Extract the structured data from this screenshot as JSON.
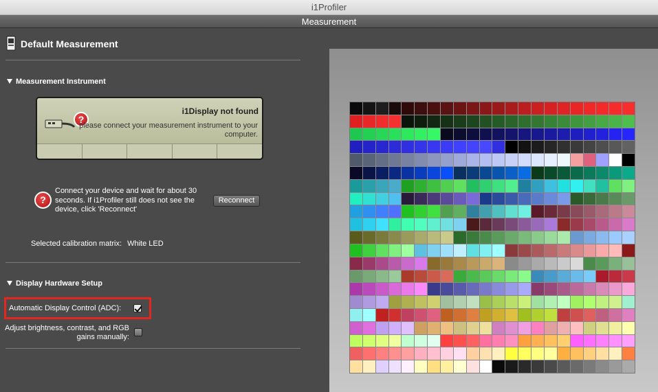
{
  "window": {
    "title": "i1Profiler"
  },
  "tab": {
    "label": "Measurement"
  },
  "header": {
    "title": "Default Measurement",
    "icon": "document-icon"
  },
  "instrument": {
    "section_title": "Measurement Instrument",
    "device_status": "i1Display not found",
    "device_message": "please connect your measurement instrument to your computer.",
    "help_text": "Connect your device and wait for about 30 seconds. If i1Profiler still does not see the device, click 'Reconnect'",
    "reconnect_label": "Reconnect",
    "calibration_label": "Selected calibration matrix:",
    "calibration_value": "White LED"
  },
  "hardware": {
    "section_title": "Display Hardware Setup",
    "adc_label": "Automatic Display Control (ADC):",
    "adc_checked": true,
    "manual_label": "Adjust brightness, contrast, and RGB gains manually:",
    "manual_checked": false
  },
  "colors": {
    "highlight": "#e5261e",
    "patches": [
      "#0a0a0a",
      "#141414",
      "#1e1e1e",
      "#1a0a0a",
      "#300a0a",
      "#3c0e0e",
      "#4a1010",
      "#5a1212",
      "#6a1414",
      "#7a1616",
      "#8a1818",
      "#9a1a1a",
      "#aa1c1c",
      "#ba1e1e",
      "#ca2020",
      "#d42222",
      "#de2424",
      "#e82626",
      "#ef2828",
      "#f22a2a",
      "#f42c2c",
      "#f62e2e",
      "#e02020",
      "#e82828",
      "#f02c2c",
      "#f43030",
      "#0a140a",
      "#0e1e0e",
      "#122812",
      "#163216",
      "#1a3c1a",
      "#1e461e",
      "#225022",
      "#265a26",
      "#2a642a",
      "#2e6e2e",
      "#327832",
      "#368236",
      "#3a8c3a",
      "#3e963e",
      "#42a042",
      "#46aa46",
      "#4ab44a",
      "#4ebe4e",
      "#1ec84e",
      "#22d052",
      "#26d856",
      "#2ae05a",
      "#2ee85e",
      "#32f062",
      "#36f866",
      "#0a0a1e",
      "#0c0c2e",
      "#0e0e3e",
      "#10104e",
      "#12125e",
      "#14146e",
      "#16167e",
      "#18188e",
      "#1a1a9e",
      "#1c1cae",
      "#1e1ebe",
      "#2020ce",
      "#2222de",
      "#2424ee",
      "#2626fe",
      "#2020c0",
      "#2424c8",
      "#2828d0",
      "#2c2cd8",
      "#3030e0",
      "#3434e8",
      "#3838f0",
      "#3c3cf8",
      "#4040ff",
      "#4444ff",
      "#4848ff",
      "#3030e0",
      "#000000",
      "#121212",
      "#1c1c1c",
      "#262626",
      "#303030",
      "#3a3a3a",
      "#444444",
      "#4e4e4e",
      "#585858",
      "#626262",
      "#505a6a",
      "#5a6478",
      "#646e86",
      "#6e7894",
      "#7882a2",
      "#828cb0",
      "#8c96be",
      "#96a0cc",
      "#a0aada",
      "#aab4e8",
      "#b4bef0",
      "#bec8f4",
      "#c8d2f8",
      "#d2dcfc",
      "#dce6ff",
      "#e6f0ff",
      "#f0f8ff",
      "#f4a0a0",
      "#e06080",
      "#a0a0ff",
      "#ffffff",
      "#000000",
      "#0a0a28",
      "#0a1446",
      "#0a1e64",
      "#0a2882",
      "#0a32a0",
      "#0a3cbe",
      "#0a46dc",
      "#0a50fa",
      "#0a3060",
      "#0a3c7a",
      "#0a4894",
      "#0a54ae",
      "#0a60c8",
      "#0a6ce2",
      "#0a3a1a",
      "#0a4a2a",
      "#0a5a3a",
      "#0a6a4a",
      "#0a7a5a",
      "#0a8a6a",
      "#0a9a7a",
      "#0aaa8a",
      "#1a9a9a",
      "#2aa0aa",
      "#3aa6ba",
      "#4aacca",
      "#20a020",
      "#30b030",
      "#40c040",
      "#50d050",
      "#60e060",
      "#20c060",
      "#30d070",
      "#40e080",
      "#50f090",
      "#2080a0",
      "#30a0c0",
      "#40c0e0",
      "#20e0e0",
      "#30f0f0",
      "#40e0c0",
      "#20c0a0",
      "#60e060",
      "#80f080",
      "#20f0c0",
      "#30e0d0",
      "#40d0e0",
      "#50c0f0",
      "#2a1a3a",
      "#3a2a5a",
      "#4a3a7a",
      "#5a4a9a",
      "#6a5aba",
      "#7a6ada",
      "#1a3a8a",
      "#2a4a9a",
      "#3a5aaa",
      "#4a6aba",
      "#5a7aca",
      "#6a8ada",
      "#7a9aea",
      "#2a5a2a",
      "#3a6a3a",
      "#4a7a4a",
      "#5a8a5a",
      "#6a9a6a",
      "#20a0e0",
      "#3090f0",
      "#4080ff",
      "#5070ff",
      "#20c020",
      "#30d030",
      "#40e040",
      "#50a050",
      "#60b060",
      "#3080a0",
      "#40a0b0",
      "#50c0c0",
      "#60e0d0",
      "#70f0e0",
      "#5a1a2a",
      "#6a2a3a",
      "#7a3a4a",
      "#8a4a5a",
      "#9a5a6a",
      "#aa6a7a",
      "#ba7a8a",
      "#ca8a9a",
      "#20c0e0",
      "#30d0f0",
      "#40e0ff",
      "#30f0a0",
      "#40ffb0",
      "#50ffc0",
      "#60f0d0",
      "#70e0e0",
      "#80d0f0",
      "#4a1a1a",
      "#5a2a3a",
      "#6a3a5a",
      "#7a4a7a",
      "#8a5a9a",
      "#9a6aba",
      "#aa7ada",
      "#8a2a2a",
      "#9a3a4a",
      "#aa4a6a",
      "#ba5a8a",
      "#ca6aaa",
      "#da7aca",
      "#5a5a1a",
      "#6a6a2a",
      "#7a7a3a",
      "#8a8a4a",
      "#9a9a5a",
      "#aaaa6a",
      "#baba7a",
      "#caca8a",
      "#2a6a2a",
      "#3a7a3a",
      "#4a8a4a",
      "#5a9a5a",
      "#6aaa6a",
      "#7aba7a",
      "#8aca8a",
      "#9ada9a",
      "#aaeaaa",
      "#6a9ad0",
      "#7aaae0",
      "#8abaf0",
      "#9acaff",
      "#aad0ff",
      "#20c020",
      "#40d040",
      "#60e060",
      "#80f080",
      "#a0ffa0",
      "#60c0e0",
      "#80d0f0",
      "#a0e0ff",
      "#c0f0ff",
      "#60e0e0",
      "#80f0f0",
      "#a0ffff",
      "#8a3a3a",
      "#9a4a4a",
      "#aa5a5a",
      "#ba6a6a",
      "#ca7a7a",
      "#da8a8a",
      "#ea9a9a",
      "#faaaaa",
      "#ffbaba",
      "#8a1a1a",
      "#8a2a4a",
      "#9a3a6a",
      "#aa4a8a",
      "#ba5aaa",
      "#ca6aca",
      "#da7aea",
      "#8a6a2a",
      "#9a7a3a",
      "#aa8a4a",
      "#ba9a5a",
      "#caaa6a",
      "#dab47a",
      "#8a8a8a",
      "#9a9a9a",
      "#aaaaaa",
      "#bababa",
      "#cacaca",
      "#dadada",
      "#4a8a4a",
      "#5a9a5a",
      "#7ab07a",
      "#9ac09a",
      "#6a9a6a",
      "#7aaa7a",
      "#8aba8a",
      "#9aca9a",
      "#aa3a2a",
      "#ba4a3a",
      "#ca5a4a",
      "#da6a5a",
      "#3aaa3a",
      "#4aba4a",
      "#5aca5a",
      "#6ada6a",
      "#7aea7a",
      "#8afa8a",
      "#3a8aba",
      "#4a9aca",
      "#5aaada",
      "#6abaea",
      "#7acafa",
      "#aa1a2a",
      "#ba2a3a",
      "#ca3a4a",
      "#aa3aaa",
      "#ba4aba",
      "#ca5aca",
      "#da6ada",
      "#ea7aea",
      "#fa8afa",
      "#3a3a8a",
      "#4a4a9a",
      "#5a5aaa",
      "#6a6aba",
      "#7a7aca",
      "#8a8ada",
      "#9a9aea",
      "#aaaafa",
      "#8a3a6a",
      "#9a4a7a",
      "#aa5a8a",
      "#ba6a9a",
      "#ca7aaa",
      "#da8aba",
      "#ea9aca",
      "#faaada",
      "#a08ad0",
      "#b09ae0",
      "#c0aaf0",
      "#a0a040",
      "#b0b050",
      "#c0c060",
      "#d0d070",
      "#a0c0a0",
      "#b0d0b0",
      "#c0e0c0",
      "#9ac04a",
      "#aad05a",
      "#bae06a",
      "#caf07a",
      "#a0e0a0",
      "#b0f0b0",
      "#c0ffc0",
      "#a0f060",
      "#b0ff70",
      "#c0f080",
      "#d0f090",
      "#a0f0d0",
      "#90f0f0",
      "#a0ffff",
      "#c02020",
      "#d03030",
      "#c04060",
      "#d05070",
      "#e06080",
      "#c06020",
      "#d07030",
      "#e08040",
      "#c0a020",
      "#d0b030",
      "#e0c040",
      "#a0c020",
      "#b0d030",
      "#c0e040",
      "#c04040",
      "#d05050",
      "#e06060",
      "#c06080",
      "#d070a0",
      "#e080c0",
      "#d060d0",
      "#e070e0",
      "#c0a0f0",
      "#d0b0ff",
      "#e0c0ff",
      "#d0a060",
      "#e0b070",
      "#f0c080",
      "#d0c080",
      "#e0d090",
      "#f0e0a0",
      "#d080c0",
      "#e090d0",
      "#f0a0e0",
      "#ff80c0",
      "#e0a0a0",
      "#f0b0b0",
      "#ffc0c0",
      "#d0d080",
      "#e0e090",
      "#f0f0a0",
      "#ffffb0",
      "#c0ff60",
      "#d0ff70",
      "#e0ff80",
      "#f0ffa0",
      "#c0ffd0",
      "#d0ffe0",
      "#e0fff0",
      "#ff4040",
      "#ff5050",
      "#ff6060",
      "#ff70a0",
      "#ff80b0",
      "#ff90c0",
      "#ffa040",
      "#ffb050",
      "#ffc060",
      "#ffd070",
      "#ff60ff",
      "#ff70ff",
      "#ff80ff",
      "#ff90ff",
      "#ffa0ff",
      "#f06060",
      "#ff7070",
      "#ff8080",
      "#ff9090",
      "#ffa0a0",
      "#ffb0c0",
      "#ffc0d0",
      "#ffd0e0",
      "#ffe0f0",
      "#ffd0a0",
      "#ffe0b0",
      "#fff0c0",
      "#ffff40",
      "#ffff60",
      "#ffff80",
      "#ffffa0",
      "#ffb040",
      "#ffc060",
      "#ffd080",
      "#ffe0a0",
      "#fff0c0",
      "#ff8040",
      "#ffe0a0",
      "#fff0c0",
      "#e0d0ff",
      "#f0e0ff",
      "#fff0ff",
      "#ffffc0",
      "#ffe080",
      "#fff0a0",
      "#ffffd0",
      "#ffe0e0",
      "#ffffff",
      "#0a0a0a",
      "#1a1a1a",
      "#2a2a2a",
      "#3a3a3a",
      "#4a4a4a",
      "#5a5a5a",
      "#6a6a6a",
      "#7a7a7a",
      "#8a8a8a",
      "#9a9a9a",
      "#aaaaaa"
    ]
  }
}
